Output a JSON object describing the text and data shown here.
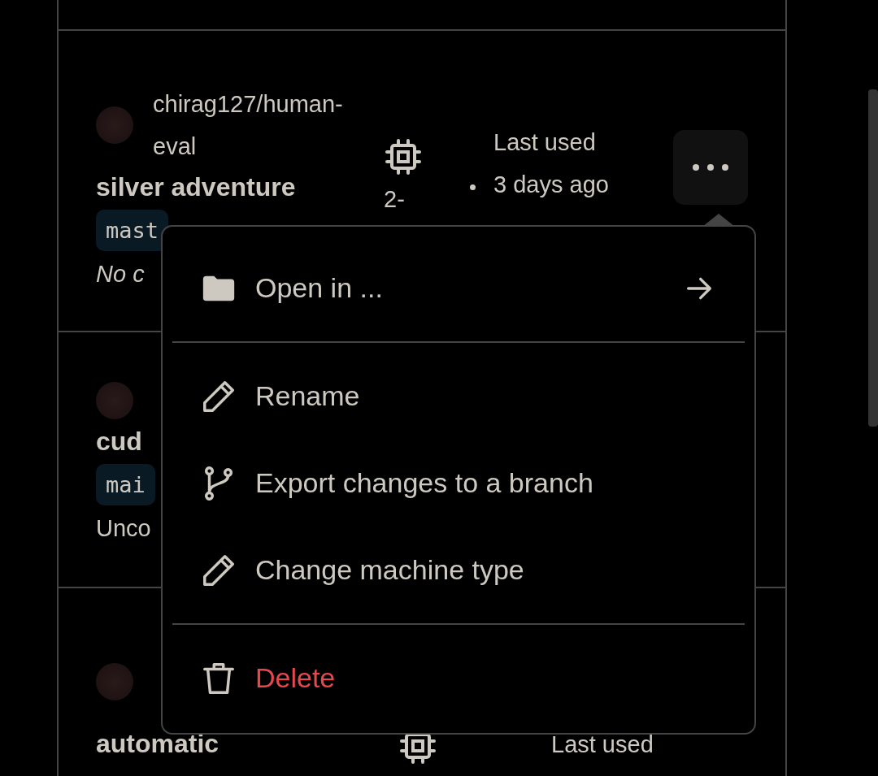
{
  "codespaces": [
    {
      "repository_lines": [
        "chirag127/human-",
        "eval"
      ],
      "name": "silver adventure",
      "branch": "mast",
      "status": "No c",
      "uncommitted_changes": false,
      "machine": "2-",
      "last_used_lines": [
        "Last used",
        "3 days ago"
      ],
      "more_button": true
    },
    {
      "name": "cud",
      "branch": "mai",
      "status": "Unco",
      "uncommitted_changes": true,
      "more_button": false
    },
    {
      "name": "automatic",
      "last_used_lines": [
        "Last used"
      ],
      "more_button": false
    }
  ],
  "menu": {
    "sections": [
      [
        {
          "kind": "open",
          "label": "Open in ...",
          "submenu": true,
          "danger": false
        }
      ],
      [
        {
          "kind": "rename",
          "label": "Rename",
          "submenu": false,
          "danger": false
        },
        {
          "kind": "export",
          "label": "Export changes to a branch",
          "submenu": false,
          "danger": false
        },
        {
          "kind": "machine",
          "label": "Change machine type",
          "submenu": false,
          "danger": false
        }
      ],
      [
        {
          "kind": "delete",
          "label": "Delete",
          "submenu": false,
          "danger": true
        }
      ]
    ]
  }
}
